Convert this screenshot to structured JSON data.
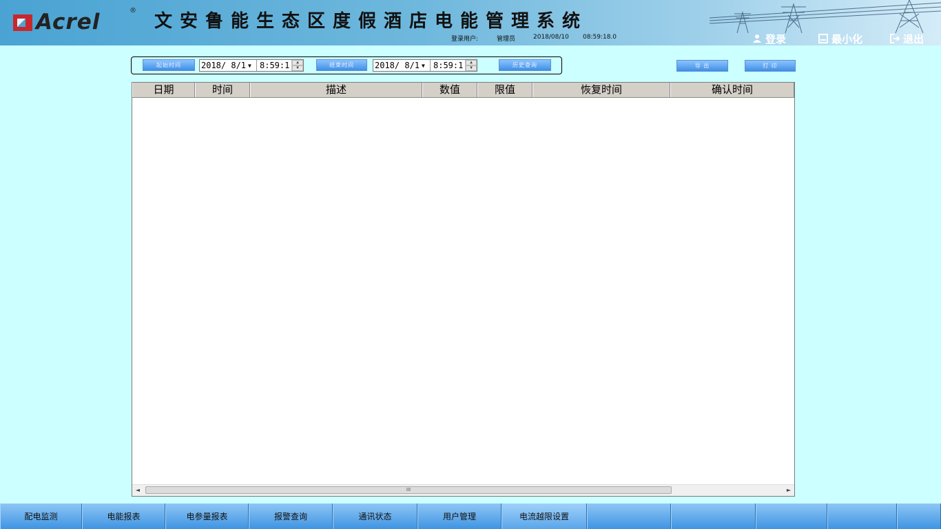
{
  "header": {
    "logo_text": "Acrel",
    "logo_reg": "®",
    "title": "文安鲁能生态区度假酒店电能管理系统",
    "user_label": "登录用户:",
    "user_name": "管理员",
    "date": "2018/08/10",
    "time": "08:59:18.0",
    "login_label": "登录",
    "minimize_label": "最小化",
    "exit_label": "退出",
    "brand_red": "#c8282d"
  },
  "toolbar": {
    "start_time_label": "起始时间",
    "start_date": "2018/ 8/1",
    "start_time": "8:59:1",
    "end_time_label": "结束时间",
    "end_date": "2018/ 8/1",
    "end_time": "8:59:1",
    "query_label": "历史查询",
    "export_label": "导 出",
    "print_label": "打 印"
  },
  "table": {
    "columns": [
      "日期",
      "时间",
      "描述",
      "数值",
      "限值",
      "恢复时间",
      "确认时间"
    ],
    "rows": [],
    "scroll_thumb": "III"
  },
  "nav": {
    "items": [
      "配电监测",
      "电能报表",
      "电参量报表",
      "报警查询",
      "通讯状态",
      "用户管理",
      "电流越限设置",
      "",
      "",
      "",
      "",
      ""
    ]
  }
}
